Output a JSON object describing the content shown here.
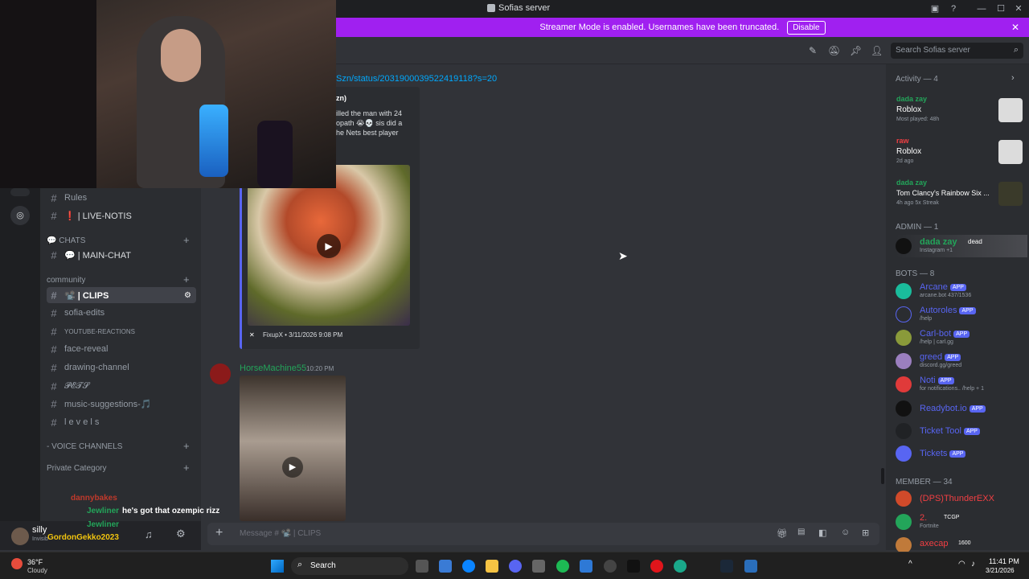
{
  "window": {
    "title": "Sofias server"
  },
  "banner": {
    "text": "Streamer Mode is enabled. Usernames have been truncated.",
    "button": "Disable"
  },
  "header": {
    "search_placeholder": "Search Sofias server"
  },
  "channels": {
    "items": [
      {
        "label": "Rules"
      },
      {
        "label": "❗ | LIVE-NOTIS"
      },
      {
        "label": "💬 | MAIN-CHAT"
      },
      {
        "label": "📽️ | CLIPS"
      },
      {
        "label": "sofia-edits"
      },
      {
        "label": "YOUTUBE-REACTIONS"
      },
      {
        "label": "face-reveal"
      },
      {
        "label": "drawing-channel"
      },
      {
        "label": "𝓟𝓔𝓣𝓢"
      },
      {
        "label": "music-suggestions-🎵"
      },
      {
        "label": "l e v e l s"
      }
    ],
    "categories": {
      "chats": "💬 CHATS",
      "community": "community",
      "voice": "- VOICE CHANNELS",
      "private": "Private Category"
    }
  },
  "user": {
    "name": "silly",
    "status": "Invisib"
  },
  "chat": {
    "link": "Szn/status/2031900039522419118?s=20",
    "embed_author": "zn)",
    "embed_text_1": "illed the man with 24",
    "embed_text_2": "opath 😭💀 sis did a",
    "embed_text_3": "he Nets best player",
    "embed_footer": "FixupX • 3/11/2026 9:08 PM",
    "message_author": "HorseMachine55",
    "message_time": "10:20 PM",
    "composer_placeholder": "Message # 📽️ | CLIPS"
  },
  "stream_chat": {
    "line1_user": "dannybakes",
    "line2_user": "Jewliner",
    "line2_text": "he's got that ozempic rizz",
    "line3_user": "Jewliner",
    "line4_user": "GordonGekko2023"
  },
  "members": {
    "activity_header": "Activity — 4",
    "activities": [
      {
        "user": "dada zay",
        "game": "Roblox",
        "detail": "Most played: 48h"
      },
      {
        "user": "raw",
        "game": "Roblox",
        "detail": "2d ago"
      },
      {
        "user": "dada zay",
        "game": "Tom Clancy's Rainbow Six ...",
        "detail": "4h ago   5x Streak"
      }
    ],
    "admin_header": "ADMIN — 1",
    "admin": {
      "name": "dada zay",
      "tag": "dead",
      "sub": "Instagram +1"
    },
    "bots_header": "BOTS — 8",
    "bots": [
      {
        "name": "Arcane",
        "sub": "arcane.bot 437/1536"
      },
      {
        "name": "Autoroles",
        "sub": "/help"
      },
      {
        "name": "Carl-bot",
        "sub": "/help | carl.gg"
      },
      {
        "name": "greed",
        "sub": "discord.gg/greed"
      },
      {
        "name": "Noti",
        "sub": "for notifications.. /help + 1"
      },
      {
        "name": "Readybot.io",
        "sub": ""
      },
      {
        "name": "Ticket Tool",
        "sub": ""
      },
      {
        "name": "Tickets",
        "sub": ""
      }
    ],
    "app_label": "APP",
    "member_header": "MEMBER — 34",
    "members": [
      {
        "name": "(DPS)ThunderEXX",
        "sub": ""
      },
      {
        "name": "2.",
        "sub": "Fortnite",
        "tag": "TCGP"
      },
      {
        "name": "axecap",
        "sub": "",
        "tag": "1600"
      }
    ]
  },
  "taskbar": {
    "weather_temp": "36°F",
    "weather_desc": "Cloudy",
    "search": "Search",
    "time": "11:41 PM",
    "date": "3/21/2026"
  },
  "colors": {
    "accent": "#a020f0",
    "blurple": "#5865f2",
    "green": "#23a55a"
  }
}
